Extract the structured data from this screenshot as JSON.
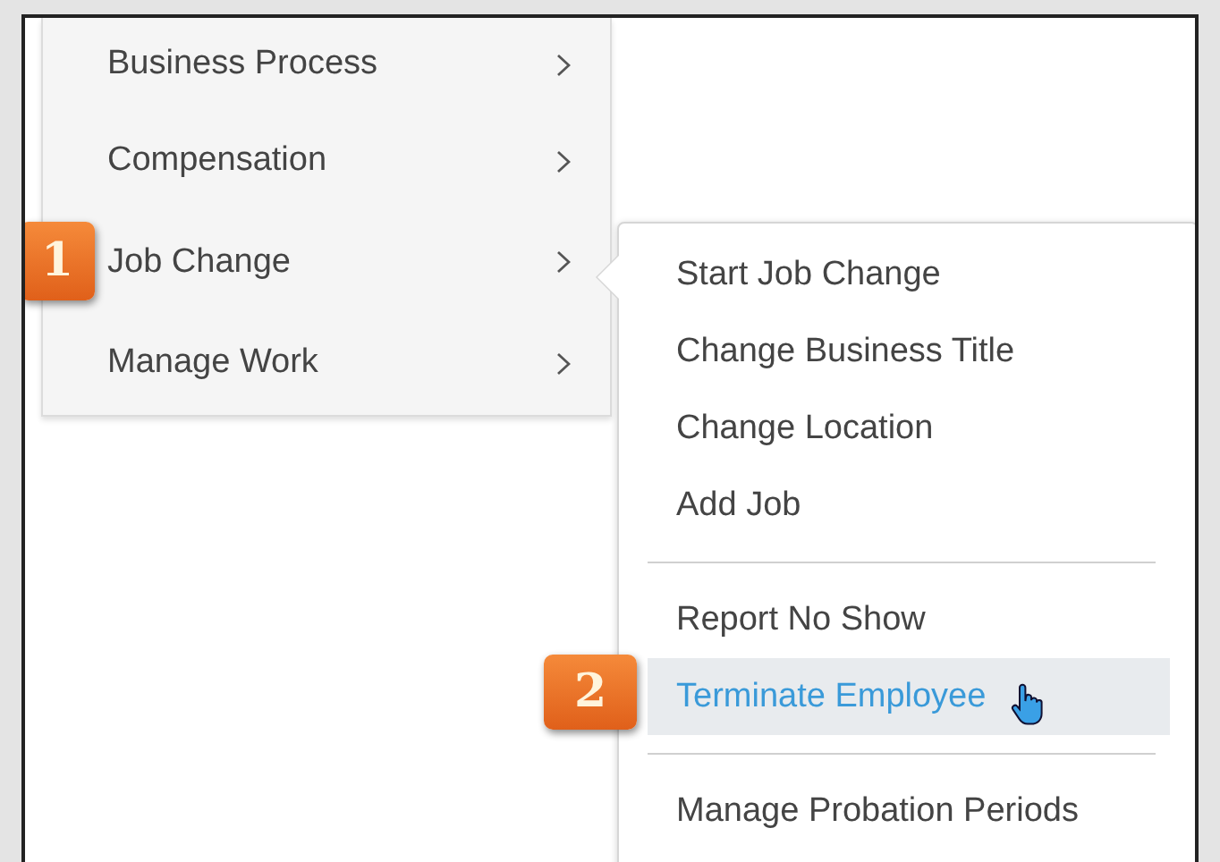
{
  "menu": {
    "items": [
      {
        "label": "Business Process"
      },
      {
        "label": "Compensation"
      },
      {
        "label": "Job Change",
        "callout": "1"
      },
      {
        "label": "Manage Work"
      }
    ]
  },
  "submenu": {
    "groups": [
      [
        {
          "label": "Start Job Change",
          "selected": false
        },
        {
          "label": "Change Business Title",
          "selected": false
        },
        {
          "label": "Change Location",
          "selected": false
        },
        {
          "label": "Add Job",
          "selected": false
        }
      ],
      [
        {
          "label": "Report No Show",
          "selected": false
        },
        {
          "label": "Terminate Employee",
          "selected": true,
          "callout": "2"
        }
      ],
      [
        {
          "label": "Manage Probation Periods",
          "selected": false
        }
      ]
    ]
  }
}
